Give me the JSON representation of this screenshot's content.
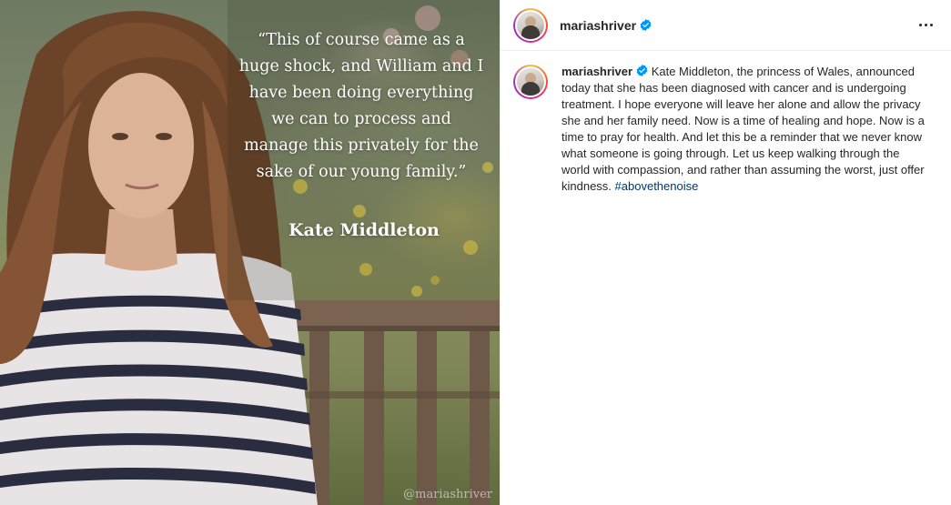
{
  "post": {
    "image": {
      "quote": "“This of course came as a huge shock, and William and I have been doing everything we can to process and manage this privately for the sake of our young family.”",
      "attribution": "Kate Middleton",
      "watermark": "@mariashriver"
    },
    "header": {
      "username": "mariashriver",
      "verified": true,
      "more_icon": "more-horizontal-icon"
    },
    "caption": {
      "username": "mariashriver",
      "text": "Kate Middleton, the princess of Wales, announced today that she has been diagnosed with cancer and is undergoing treatment. I hope everyone will leave her alone and allow the privacy she and her family need. Now is a time of healing and hope. Now is a time to pray for health. And let this be a reminder that we never know what someone is going through. Let us keep walking through the world with compassion, and rather than assuming the worst, just offer kindness.",
      "hashtag": "#abovethenoise"
    }
  },
  "colors": {
    "verified_badge": "#0095f6",
    "hashtag": "#00376b",
    "text": "#262626"
  }
}
